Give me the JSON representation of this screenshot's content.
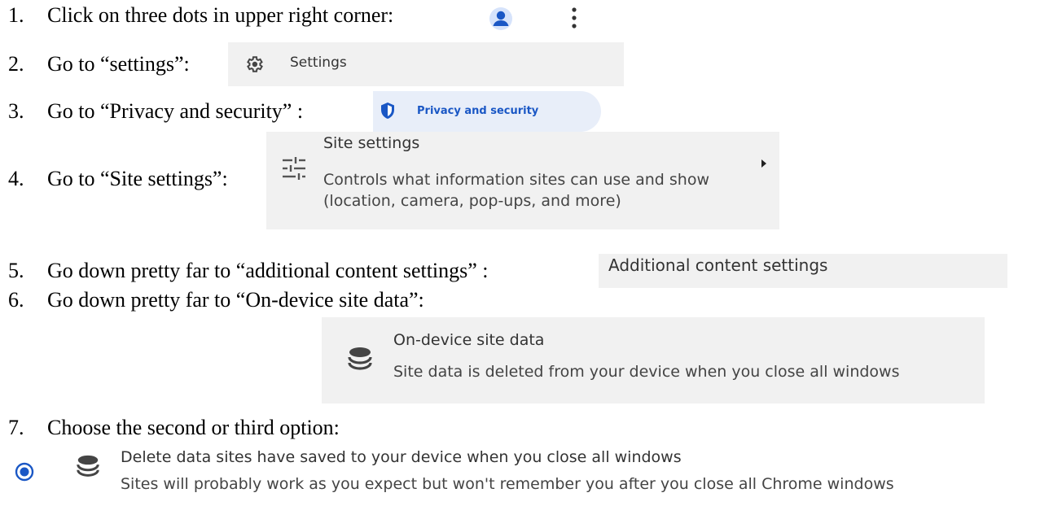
{
  "steps": [
    {
      "number": "1.",
      "text": "Click on three dots in upper right corner:"
    },
    {
      "number": "2.",
      "text": "Go to “settings”:"
    },
    {
      "number": "3.",
      "text": "Go to “Privacy and security” :"
    },
    {
      "number": "4.",
      "text": "Go to “Site settings”:"
    },
    {
      "number": "5.",
      "text": "Go down pretty far to “additional content settings” :"
    },
    {
      "number": "6.",
      "text": "Go down pretty far to “On-device site data”:"
    },
    {
      "number": "7.",
      "text": "Choose the second or third option:"
    }
  ],
  "step1": {
    "avatar_icon": "account-circle-icon",
    "menu_icon": "more-vert-icon"
  },
  "step2": {
    "icon": "gear-icon",
    "label": "Settings"
  },
  "step3": {
    "icon": "shield-icon",
    "label": "Privacy and security",
    "accent": "#1a57c5",
    "background": "#e8eef9"
  },
  "step4": {
    "icon": "tune-icon",
    "title": "Site settings",
    "description": "Controls what information sites can use and show (location, camera, pop-ups, and more)"
  },
  "step5": {
    "label": "Additional content settings"
  },
  "step6": {
    "icon": "database-icon",
    "title": "On-device site data",
    "description": "Site data is deleted from your device when you close all windows"
  },
  "step7": {
    "radio_icon": "radio-selected-icon",
    "icon": "database-icon",
    "option_title": "Delete data sites have saved to your device when you close all windows",
    "option_description": "Sites will probably work as you expect but won't remember you after you close all Chrome windows",
    "accent": "#1a57c5"
  }
}
